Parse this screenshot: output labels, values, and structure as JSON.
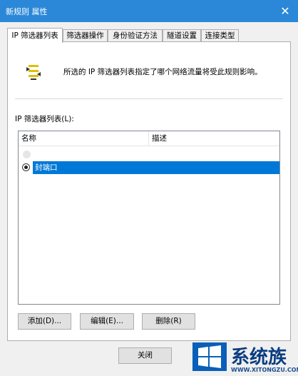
{
  "window": {
    "title": "新规则 属性",
    "close_glyph": "✕"
  },
  "tabs": [
    {
      "label": "IP 筛选器列表",
      "active": true
    },
    {
      "label": "筛选器操作",
      "active": false
    },
    {
      "label": "身份验证方法",
      "active": false
    },
    {
      "label": "隧道设置",
      "active": false
    },
    {
      "label": "连接类型",
      "active": false
    }
  ],
  "panel": {
    "description": "所选的 IP 筛选器列表指定了哪个网络流量将受此规则影响。",
    "list_label": "IP 筛选器列表(L):",
    "columns": [
      "名称",
      "描述"
    ],
    "rows": [
      {
        "name": "封端口",
        "description": "",
        "selected": true
      }
    ]
  },
  "buttons": {
    "add": "添加(D)...",
    "edit": "编辑(E)...",
    "delete": "删除(R)"
  },
  "footer": {
    "close": "关闭"
  },
  "watermark": {
    "text": "系统族",
    "url": "WWW.XITONGZU.COM"
  },
  "colors": {
    "titlebar": "#2b88d8",
    "selection": "#0078d7"
  }
}
